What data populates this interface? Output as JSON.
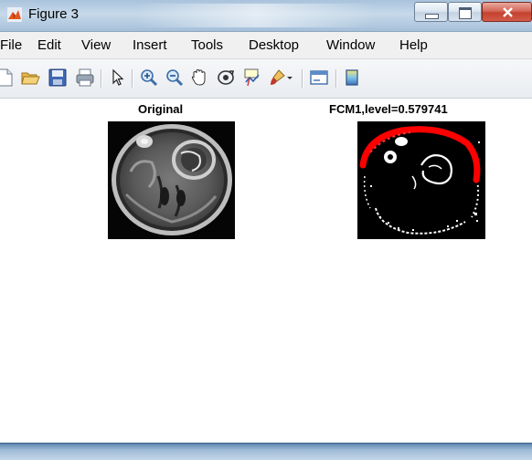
{
  "window": {
    "title": "Figure 3",
    "app_icon": "matlab-icon",
    "controls": [
      "minimize-icon",
      "maximize-icon",
      "close-icon"
    ]
  },
  "menu": {
    "items": [
      "File",
      "Edit",
      "View",
      "Insert",
      "Tools",
      "Desktop",
      "Window",
      "Help"
    ]
  },
  "toolbar": {
    "icons": [
      "new-figure-icon",
      "open-file-icon",
      "save-icon",
      "print-icon",
      "select-pointer-icon",
      "zoom-in-icon",
      "zoom-out-icon",
      "pan-hand-icon",
      "rotate-3d-icon",
      "data-cursor-icon",
      "brush-icon",
      "dropdown-arrow-icon",
      "link-plot-icon",
      "colorbar-icon"
    ]
  },
  "axes": [
    {
      "title": "Original",
      "image": "brain MRI scan, grayscale"
    },
    {
      "title": "FCM1,level=0.579741",
      "image": "binary segmentation with red tumor boundary"
    }
  ],
  "colors": {
    "titlebar": "#b8cde3",
    "boundary": "#ff0000",
    "menubar": "#f0f0f0"
  }
}
